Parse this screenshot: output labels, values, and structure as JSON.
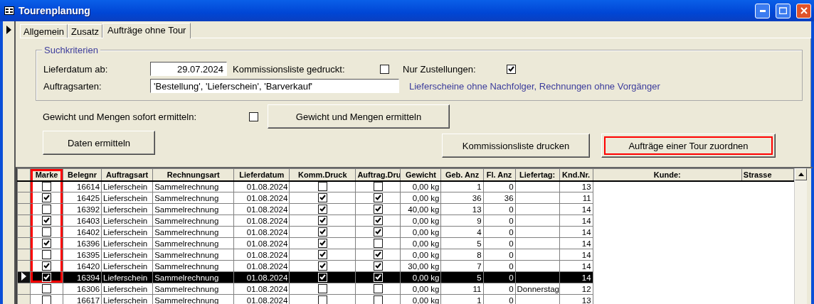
{
  "window": {
    "title": "Tourenplanung"
  },
  "tabs": [
    {
      "label": "Allgemein",
      "selected": false
    },
    {
      "label": "Zusatz",
      "selected": false
    },
    {
      "label": "Aufträge ohne Tour",
      "selected": true
    }
  ],
  "search_criteria": {
    "legend": "Suchkriterien",
    "date_label": "Lieferdatum ab:",
    "date_value": "29.07.2024",
    "printed_label": "Kommissionsliste gedruckt:",
    "printed_checked": false,
    "delivery_label": "Nur Zustellungen:",
    "delivery_checked": true,
    "types_label": "Auftragsarten:",
    "types_value": "'Bestellung', 'Lieferschein', 'Barverkauf'",
    "hint": "Lieferscheine ohne Nachfolger, Rechnungen ohne Vorgänger"
  },
  "immediate": {
    "label": "Gewicht und Mengen sofort ermitteln:",
    "checked": false
  },
  "buttons": [
    {
      "label": "Gewicht und Mengen ermitteln",
      "highlighted": false
    },
    {
      "label": "Daten ermitteln",
      "highlighted": false
    },
    {
      "label": "Kommissionsliste drucken",
      "highlighted": false
    },
    {
      "label": "Aufträge einer Tour zuordnen",
      "highlighted": true
    }
  ],
  "table": {
    "columns": [
      "Marke",
      "Belegnr",
      "Auftragsart",
      "Rechnungsart",
      "Lieferdatum",
      "Komm.Druck",
      "Auftrag.Dru",
      "Gewicht",
      "Geb. Anz",
      "Fl. Anz",
      "Liefertag:",
      "Knd.Nr.",
      "Kunde:",
      "Strasse"
    ],
    "marke_highlighted": true,
    "rows": [
      {
        "selected": false,
        "marke": false,
        "belegnr": "16614",
        "auftragsart": "Lieferschein",
        "rechnungsart": "Sammelrechnung",
        "lieferdatum": "01.08.2024",
        "komm_druck": false,
        "auftrag_druck": false,
        "gewicht": "0,00 kg",
        "geb_anz": "1",
        "fl_anz": "0",
        "liefertag": "",
        "knd_nr": "13"
      },
      {
        "selected": false,
        "marke": true,
        "belegnr": "16425",
        "auftragsart": "Lieferschein",
        "rechnungsart": "Sammelrechnung",
        "lieferdatum": "01.08.2024",
        "komm_druck": true,
        "auftrag_druck": true,
        "gewicht": "0,00 kg",
        "geb_anz": "36",
        "fl_anz": "36",
        "liefertag": "",
        "knd_nr": "11"
      },
      {
        "selected": false,
        "marke": false,
        "belegnr": "16392",
        "auftragsart": "Lieferschein",
        "rechnungsart": "Sammelrechnung",
        "lieferdatum": "01.08.2024",
        "komm_druck": true,
        "auftrag_druck": true,
        "gewicht": "40,00 kg",
        "geb_anz": "13",
        "fl_anz": "0",
        "liefertag": "",
        "knd_nr": "14"
      },
      {
        "selected": false,
        "marke": true,
        "belegnr": "16403",
        "auftragsart": "Lieferschein",
        "rechnungsart": "Sammelrechnung",
        "lieferdatum": "01.08.2024",
        "komm_druck": true,
        "auftrag_druck": true,
        "gewicht": "0,00 kg",
        "geb_anz": "9",
        "fl_anz": "0",
        "liefertag": "",
        "knd_nr": "14"
      },
      {
        "selected": false,
        "marke": false,
        "belegnr": "16402",
        "auftragsart": "Lieferschein",
        "rechnungsart": "Sammelrechnung",
        "lieferdatum": "01.08.2024",
        "komm_druck": true,
        "auftrag_druck": true,
        "gewicht": "0,00 kg",
        "geb_anz": "4",
        "fl_anz": "0",
        "liefertag": "",
        "knd_nr": "14"
      },
      {
        "selected": false,
        "marke": true,
        "belegnr": "16396",
        "auftragsart": "Lieferschein",
        "rechnungsart": "Sammelrechnung",
        "lieferdatum": "01.08.2024",
        "komm_druck": true,
        "auftrag_druck": false,
        "gewicht": "0,00 kg",
        "geb_anz": "5",
        "fl_anz": "0",
        "liefertag": "",
        "knd_nr": "14"
      },
      {
        "selected": false,
        "marke": false,
        "belegnr": "16395",
        "auftragsart": "Lieferschein",
        "rechnungsart": "Sammelrechnung",
        "lieferdatum": "01.08.2024",
        "komm_druck": true,
        "auftrag_druck": true,
        "gewicht": "0,00 kg",
        "geb_anz": "8",
        "fl_anz": "0",
        "liefertag": "",
        "knd_nr": "14"
      },
      {
        "selected": false,
        "marke": true,
        "belegnr": "16420",
        "auftragsart": "Lieferschein",
        "rechnungsart": "Sammelrechnung",
        "lieferdatum": "01.08.2024",
        "komm_druck": true,
        "auftrag_druck": true,
        "gewicht": "30,00 kg",
        "geb_anz": "7",
        "fl_anz": "0",
        "liefertag": "",
        "knd_nr": "14"
      },
      {
        "selected": true,
        "marke": true,
        "belegnr": "16394",
        "auftragsart": "Lieferschein",
        "rechnungsart": "Sammelrechnung",
        "lieferdatum": "01.08.2024",
        "komm_druck": true,
        "auftrag_druck": true,
        "gewicht": "0,00 kg",
        "geb_anz": "5",
        "fl_anz": "0",
        "liefertag": "",
        "knd_nr": "14"
      },
      {
        "selected": false,
        "marke": false,
        "belegnr": "16306",
        "auftragsart": "Lieferschein",
        "rechnungsart": "Sammelrechnung",
        "lieferdatum": "01.08.2024",
        "komm_druck": false,
        "auftrag_druck": false,
        "gewicht": "0,00 kg",
        "geb_anz": "11",
        "fl_anz": "0",
        "liefertag": "Donnerstag",
        "knd_nr": "12"
      },
      {
        "selected": false,
        "marke": false,
        "belegnr": "16617",
        "auftragsart": "Lieferschein",
        "rechnungsart": "Sammelrechnung",
        "lieferdatum": "01.08.2024",
        "komm_druck": false,
        "auftrag_druck": false,
        "gewicht": "0,00 kg",
        "geb_anz": "1",
        "fl_anz": "0",
        "liefertag": "",
        "knd_nr": "13"
      }
    ]
  }
}
